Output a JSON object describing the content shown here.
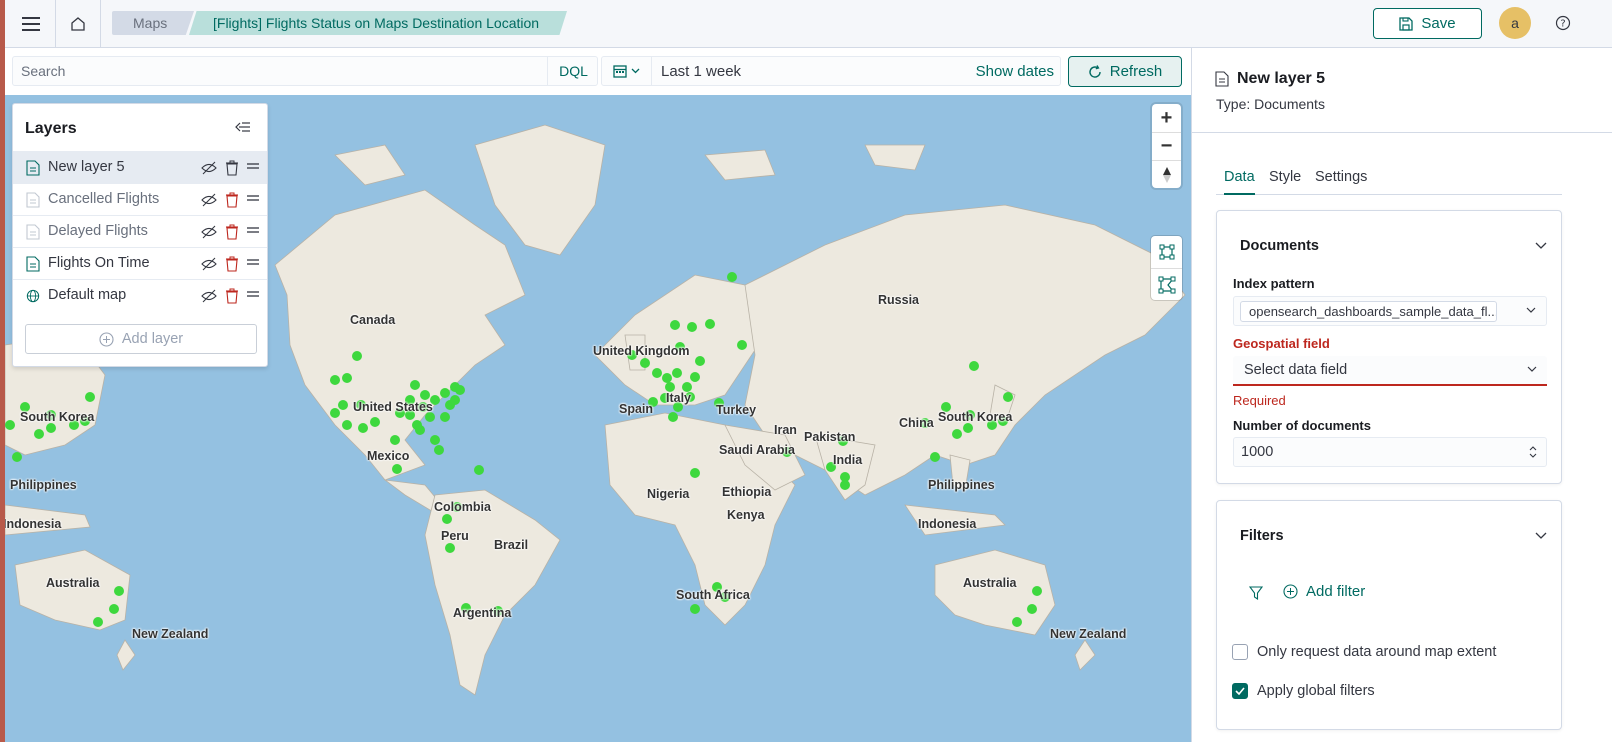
{
  "header": {
    "breadcrumbs": [
      "Maps",
      "[Flights] Flights Status on Maps Destination Location"
    ],
    "save_label": "Save",
    "avatar_letter": "a"
  },
  "query": {
    "search_placeholder": "Search",
    "language": "DQL",
    "date_range": "Last 1 week",
    "show_dates_label": "Show dates",
    "refresh_label": "Refresh"
  },
  "layers_panel": {
    "title": "Layers",
    "items": [
      {
        "name": "New layer 5",
        "type": "documents",
        "selected": true
      },
      {
        "name": "Cancelled Flights",
        "type": "documents",
        "selected": false
      },
      {
        "name": "Delayed Flights",
        "type": "documents",
        "selected": false
      },
      {
        "name": "Flights On Time",
        "type": "documents",
        "selected": false
      },
      {
        "name": "Default map",
        "type": "base-map",
        "selected": false
      }
    ],
    "add_layer_label": "Add layer"
  },
  "map": {
    "labels": [
      "Canada",
      "United States",
      "Mexico",
      "Colombia",
      "Peru",
      "Brazil",
      "Argentina",
      "United Kingdom",
      "Spain",
      "Italy",
      "Turkey",
      "Russia",
      "Iran",
      "Pakistan",
      "Saudi Arabia",
      "India",
      "Nigeria",
      "Ethiopia",
      "Kenya",
      "South Africa",
      "China",
      "South Korea",
      "Philippines",
      "Indonesia",
      "Australia",
      "New Zealand",
      "South Korea",
      "Philippines",
      "Indonesia",
      "Australia",
      "New Zealand"
    ],
    "point_color": "#3ed83e",
    "zoom_in": "+",
    "zoom_out": "−"
  },
  "config_panel": {
    "layer_title": "New layer 5",
    "layer_type": "Type: Documents",
    "tabs": [
      "Data",
      "Style",
      "Settings"
    ],
    "active_tab": "Data",
    "documents": {
      "title": "Documents",
      "index_pattern_label": "Index pattern",
      "index_pattern_value": "opensearch_dashboards_sample_data_fl...",
      "geo_field_label": "Geospatial field",
      "geo_field_placeholder": "Select data field",
      "geo_field_error": "Required",
      "num_docs_label": "Number of documents",
      "num_docs_value": "1000"
    },
    "filters": {
      "title": "Filters",
      "add_filter_label": "Add filter",
      "map_extent_label": "Only request data around map extent",
      "map_extent_checked": false,
      "global_filters_label": "Apply global filters",
      "global_filters_checked": true
    }
  },
  "colors": {
    "accent": "#006a61",
    "error": "#bd271e",
    "water": "#94c1e1",
    "land": "#ede9df",
    "points": "#3ed83e"
  }
}
